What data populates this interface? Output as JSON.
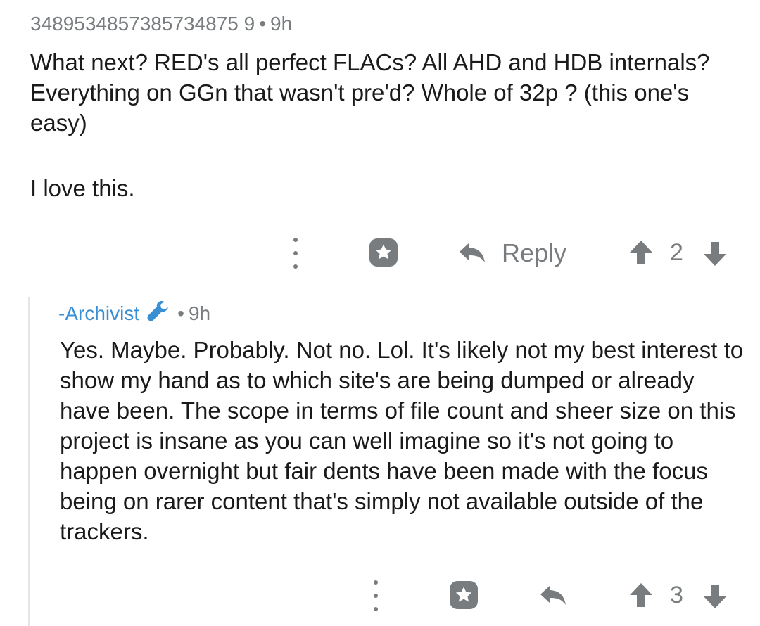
{
  "parent_comment": {
    "username": "3489534857385734875 9",
    "separator": "•",
    "age": "9h",
    "paragraphs": [
      "What next? RED's all perfect FLACs? All AHD and HDB internals? Everything on GGn that wasn't pre'd? Whole of 32p ? (this one's easy)",
      "I love this."
    ],
    "actions": {
      "more_icon": "vertical-dots-icon",
      "award_icon": "award-icon",
      "reply_icon": "reply-arrow-icon",
      "reply_label": "Reply",
      "score": "2"
    }
  },
  "reply_comment": {
    "username": "-Archivist",
    "mod_icon": "wrench-icon",
    "separator": "•",
    "age": "9h",
    "paragraphs": [
      "Yes. Maybe. Probably. Not no. Lol. It's likely not my best interest to show my hand as to which site's are being dumped or already have been. The scope in terms of file count and sheer size on this project is insane as you can well imagine so it's not going to happen overnight but fair dents have been made with the focus being on rarer content that's simply not available outside of the trackers."
    ],
    "actions": {
      "more_icon": "vertical-dots-icon",
      "award_icon": "award-icon",
      "reply_icon": "reply-arrow-icon",
      "score": "3"
    }
  },
  "colors": {
    "text": "#1a1a1b",
    "meta": "#787c7e",
    "author_link": "#3a8fd4",
    "thread_line": "#e4e5e6"
  }
}
